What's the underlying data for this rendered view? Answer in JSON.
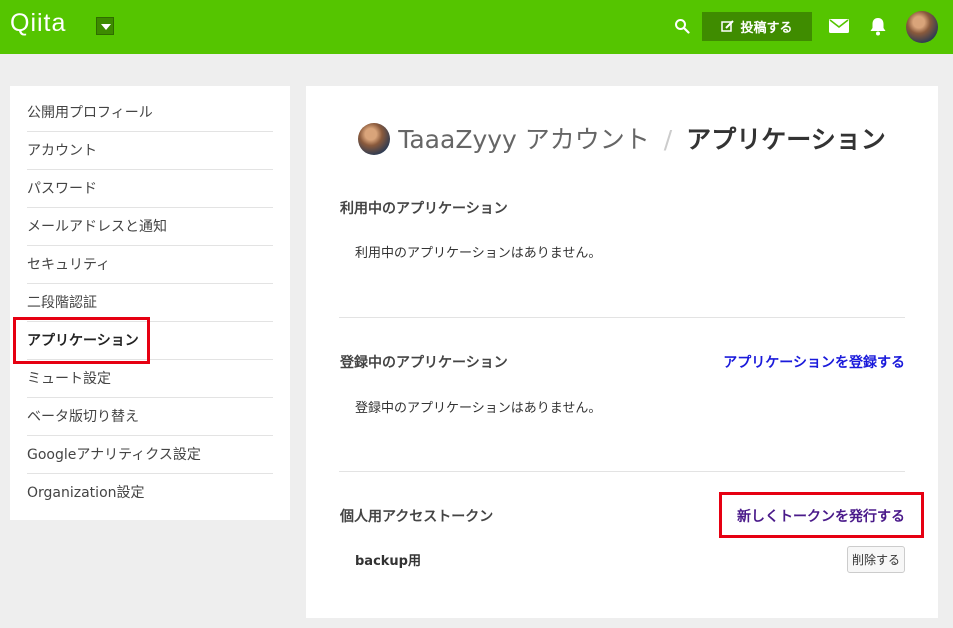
{
  "header": {
    "logo": "Qiita",
    "post_label": "投稿する",
    "accent": "#55c500"
  },
  "sidebar": {
    "items": [
      {
        "label": "公開用プロフィール"
      },
      {
        "label": "アカウント"
      },
      {
        "label": "パスワード"
      },
      {
        "label": "メールアドレスと通知"
      },
      {
        "label": "セキュリティ"
      },
      {
        "label": "二段階認証"
      },
      {
        "label": "アプリケーション"
      },
      {
        "label": "ミュート設定"
      },
      {
        "label": "ベータ版切り替え"
      },
      {
        "label": "Googleアナリティクス設定"
      },
      {
        "label": "Organization設定"
      }
    ],
    "active_index": 6
  },
  "main": {
    "title_user": "TaaaZyyy アカウント",
    "title_sep": "/",
    "title_page": "アプリケーション",
    "sections": {
      "in_use": {
        "title": "利用中のアプリケーション",
        "empty": "利用中のアプリケーションはありません。"
      },
      "registered": {
        "title": "登録中のアプリケーション",
        "link": "アプリケーションを登録する",
        "empty": "登録中のアプリケーションはありません。"
      },
      "tokens": {
        "title": "個人用アクセストークン",
        "link": "新しくトークンを発行する",
        "items": [
          {
            "name": "backup用",
            "delete_label": "削除する"
          }
        ]
      }
    }
  },
  "colors": {
    "highlight": "#e60012",
    "link": "#1a1adb"
  }
}
